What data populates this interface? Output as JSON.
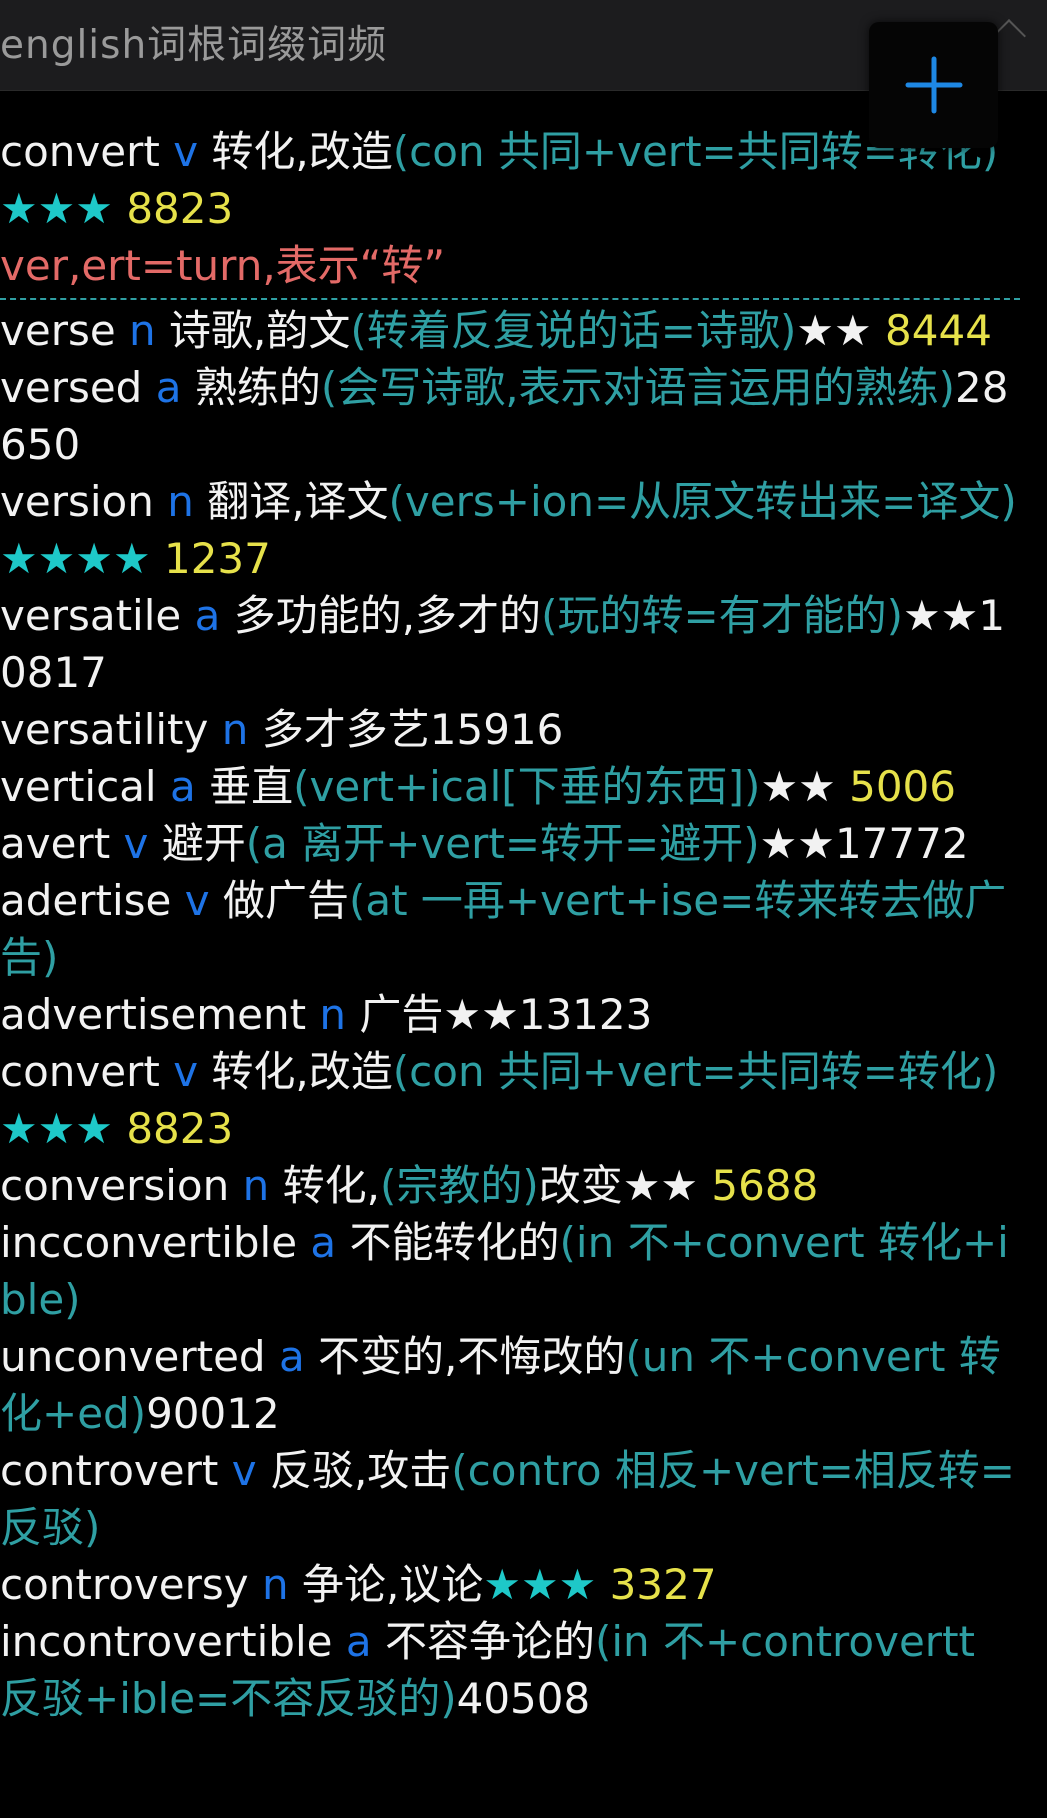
{
  "header": {
    "title": "english词根词缀词频"
  },
  "fab": {
    "icon": "plus-icon"
  },
  "top_entry": {
    "word": "convert",
    "pos": "v",
    "meaning": "转化,改造",
    "etymology": "(con 共同+vert=共同转=转化)",
    "stars": "★★★",
    "freq": "8823"
  },
  "root_note": "ver,ert=turn,表示“转”",
  "entries": [
    {
      "word": "verse",
      "pos": "n",
      "meaning": "诗歌,韵文",
      "etymology": "(转着反复说的话=诗歌)",
      "stars": "★★",
      "freq": "8444",
      "star_style": "w",
      "freq_style": "y"
    },
    {
      "word": "versed",
      "pos": "a",
      "meaning": "熟练的",
      "etymology": "(会写诗歌,表示对语言运用的熟练)",
      "stars": "",
      "freq": "28650",
      "star_style": "w",
      "freq_style": "w"
    },
    {
      "word": "version",
      "pos": "n",
      "meaning": "翻译,译文",
      "etymology": "(vers+ion=从原文转出来=译文)",
      "stars": "★★★★",
      "freq": "1237",
      "star_style": "c",
      "freq_style": "y"
    },
    {
      "word": "versatile",
      "pos": "a",
      "meaning": "多功能的,多才的",
      "etymology": "(玩的转=有才能的)",
      "stars": "★★",
      "freq": "10817",
      "star_style": "w",
      "freq_style": "w"
    },
    {
      "word": "versatility",
      "pos": "n",
      "meaning": "多才多艺",
      "etymology": "",
      "stars": "",
      "freq": "15916",
      "star_style": "w",
      "freq_style": "w"
    },
    {
      "word": "vertical",
      "pos": "a",
      "meaning": "垂直",
      "etymology": "(vert+ical[下垂的东西])",
      "stars": "★★",
      "freq": "5006",
      "star_style": "w",
      "freq_style": "y"
    },
    {
      "word": "avert",
      "pos": "v",
      "meaning": "避开",
      "etymology": "(a 离开+vert=转开=避开)",
      "stars": "★★",
      "freq": "17772",
      "star_style": "w",
      "freq_style": "w"
    },
    {
      "word": "adertise",
      "pos": "v",
      "meaning": "做广告",
      "etymology": "(at 一再+vert+ise=转来转去做广告)",
      "stars": "",
      "freq": "",
      "star_style": "w",
      "freq_style": "w"
    },
    {
      "word": "advertisement",
      "pos": "n",
      "meaning": "广告",
      "etymology": "",
      "stars": "★★",
      "freq": "13123",
      "star_style": "w",
      "freq_style": "w"
    },
    {
      "word": "convert",
      "pos": "v",
      "meaning": "转化,改造",
      "etymology": "(con 共同+vert=共同转=转化)",
      "stars": "★★★",
      "freq": "8823",
      "star_style": "c",
      "freq_style": "y"
    },
    {
      "word": "conversion",
      "pos": "n",
      "meaning": "转化,",
      "etymology": "(宗教的)",
      "meaning2": "改变",
      "stars": "★★",
      "freq": "5688",
      "star_style": "w",
      "freq_style": "y"
    },
    {
      "word": "incconvertible",
      "pos": "a",
      "meaning": "不能转化的",
      "etymology": "(in 不+convert 转化+ible)",
      "stars": "",
      "freq": "",
      "star_style": "w",
      "freq_style": "w"
    },
    {
      "word": "unconverted",
      "pos": "a",
      "meaning": "不变的,不悔改的",
      "etymology": "(un 不+convert 转化+ed)",
      "stars": "",
      "freq": "90012",
      "star_style": "w",
      "freq_style": "w"
    },
    {
      "word": "controvert",
      "pos": "v",
      "meaning": "反驳,攻击",
      "etymology": "(contro 相反+vert=相反转=反驳)",
      "stars": "",
      "freq": "",
      "star_style": "w",
      "freq_style": "w"
    },
    {
      "word": "controversy",
      "pos": "n",
      "meaning": "争论,议论",
      "etymology": "",
      "stars": "★★★",
      "freq": "3327",
      "star_style": "c",
      "freq_style": "y"
    },
    {
      "word": "incontrovertible",
      "pos": "a",
      "meaning": "不容争论的",
      "etymology": "(in 不+controvertt 反驳+ible=不容反驳的)",
      "stars": "",
      "freq": "40508",
      "star_style": "w",
      "freq_style": "w"
    }
  ]
}
